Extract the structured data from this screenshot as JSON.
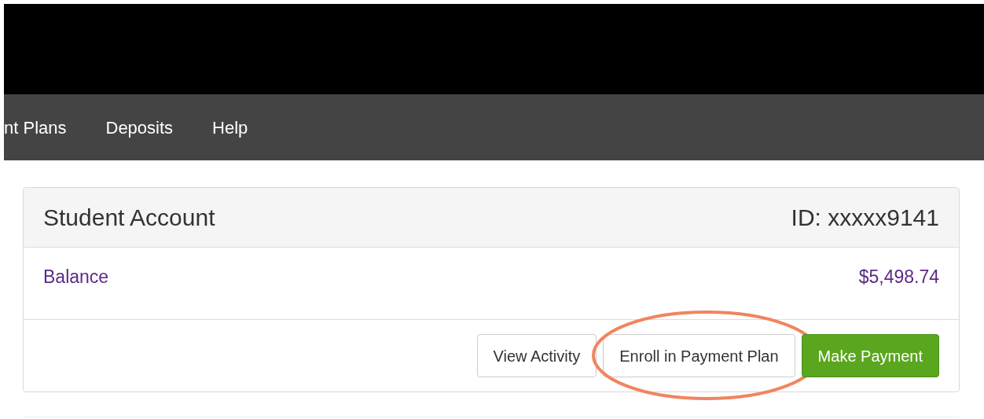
{
  "nav": {
    "items": [
      "nt Plans",
      "Deposits",
      "Help"
    ]
  },
  "card": {
    "title": "Student Account",
    "id_text": "ID: xxxxx9141",
    "balance_label": "Balance",
    "balance_value": "$5,498.74",
    "buttons": [
      {
        "label": "View Activity",
        "kind": "default",
        "highlighted": false
      },
      {
        "label": "Enroll in Payment Plan",
        "kind": "default",
        "highlighted": true
      },
      {
        "label": "Make Payment",
        "kind": "primary",
        "highlighted": false
      }
    ]
  }
}
